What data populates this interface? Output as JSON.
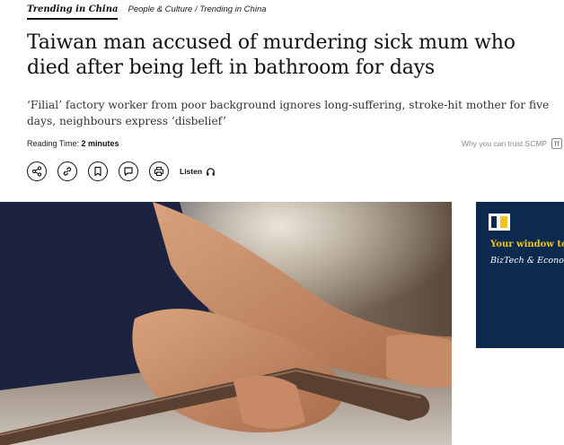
{
  "nav": {
    "section": "Trending in China",
    "breadcrumb": "People & Culture / Trending in China"
  },
  "article": {
    "headline": "Taiwan man accused of murdering sick mum who died after being left in bathroom for days",
    "subhead": "‘Filial’ factory worker from poor background ignores long-suffering, stroke-hit mother for five days, neighbours express ‘disbelief’",
    "reading_label": "Reading Time:",
    "reading_value": "2 minutes",
    "trust_link": "Why you can trust SCMP"
  },
  "actions": {
    "icons": [
      "share-icon",
      "link-icon",
      "bookmark-icon",
      "comment-icon",
      "print-icon"
    ],
    "listen_label": "Listen"
  },
  "ad": {
    "headline": "Your window to",
    "subline": "BizTech & Econo",
    "colors": {
      "background": "#0b2a4e",
      "accent": "#f0c419"
    }
  }
}
